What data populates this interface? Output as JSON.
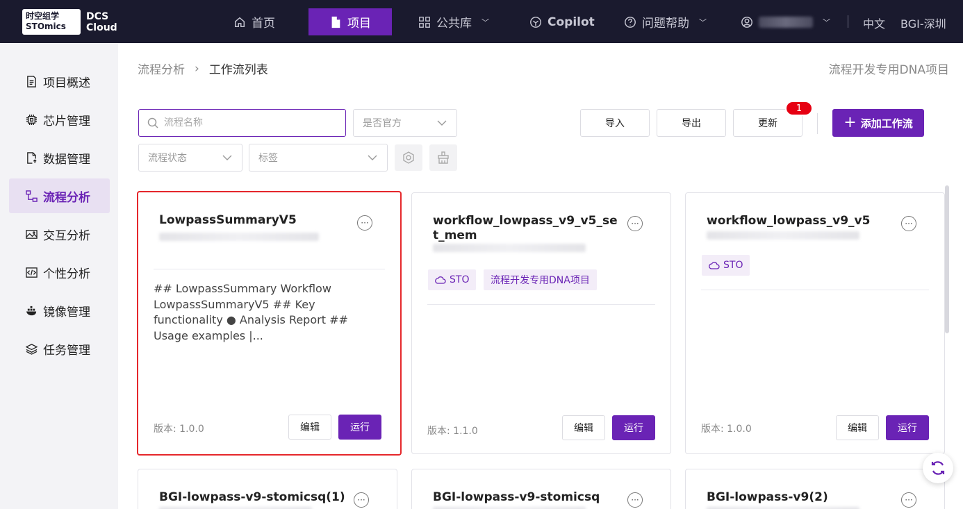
{
  "brand": {
    "logo_line1": "时空组学",
    "logo_line2": "STOmics",
    "dcs_line1": "DCS",
    "dcs_line2": "Cloud"
  },
  "topnav": {
    "items": [
      {
        "label": "首页",
        "icon": "home-icon"
      },
      {
        "label": "项目",
        "icon": "file-icon",
        "active": true
      },
      {
        "label": "公共库",
        "icon": "grid-icon"
      },
      {
        "label": "Copilot",
        "icon": "copilot-icon"
      },
      {
        "label": "问题帮助",
        "icon": "help-icon"
      }
    ],
    "language": "中文",
    "region": "BGI-深圳"
  },
  "sidebar": {
    "items": [
      {
        "label": "项目概述",
        "icon": "document-icon"
      },
      {
        "label": "芯片管理",
        "icon": "chip-icon"
      },
      {
        "label": "数据管理",
        "icon": "data-upload-icon"
      },
      {
        "label": "流程分析",
        "icon": "flow-icon",
        "active": true
      },
      {
        "label": "交互分析",
        "icon": "image-icon"
      },
      {
        "label": "个性分析",
        "icon": "code-icon"
      },
      {
        "label": "镜像管理",
        "icon": "docker-icon"
      },
      {
        "label": "任务管理",
        "icon": "layers-icon"
      }
    ]
  },
  "breadcrumb": {
    "parent": "流程分析",
    "current": "工作流列表"
  },
  "project_name": "流程开发专用DNA项目",
  "filters": {
    "search_placeholder": "流程名称",
    "official_placeholder": "是否官方",
    "status_placeholder": "流程状态",
    "tag_placeholder": "标签"
  },
  "actions": {
    "import": "导入",
    "export": "导出",
    "update": "更新",
    "update_badge": "1",
    "add_workflow": "添加工作流"
  },
  "cards": [
    {
      "title": "LowpassSummaryV5",
      "description": "## LowpassSummary Workflow LowpassSummaryV5 ## Key functionality ● Analysis Report ## Usage examples |...",
      "tags": [],
      "version_label": "版本:",
      "version": "1.0.0",
      "edit": "编辑",
      "run": "运行"
    },
    {
      "title": "workflow_lowpass_v9_v5_set_mem",
      "description": "",
      "tags": [
        "STO",
        "流程开发专用DNA项目"
      ],
      "version_label": "版本:",
      "version": "1.1.0",
      "edit": "编辑",
      "run": "运行"
    },
    {
      "title": "workflow_lowpass_v9_v5",
      "description": "",
      "tags": [
        "STO"
      ],
      "version_label": "版本:",
      "version": "1.0.0",
      "edit": "编辑",
      "run": "运行"
    },
    {
      "title": "BGI-lowpass-v9-stomicsq(1)"
    },
    {
      "title": "BGI-lowpass-v9-stomicsq"
    },
    {
      "title": "BGI-lowpass-v9(2)"
    }
  ],
  "colors": {
    "brand_purple": "#6a23b5",
    "nav_bg": "#1a1a2e",
    "badge_red": "#e60012",
    "selected_border": "#e5272b"
  }
}
